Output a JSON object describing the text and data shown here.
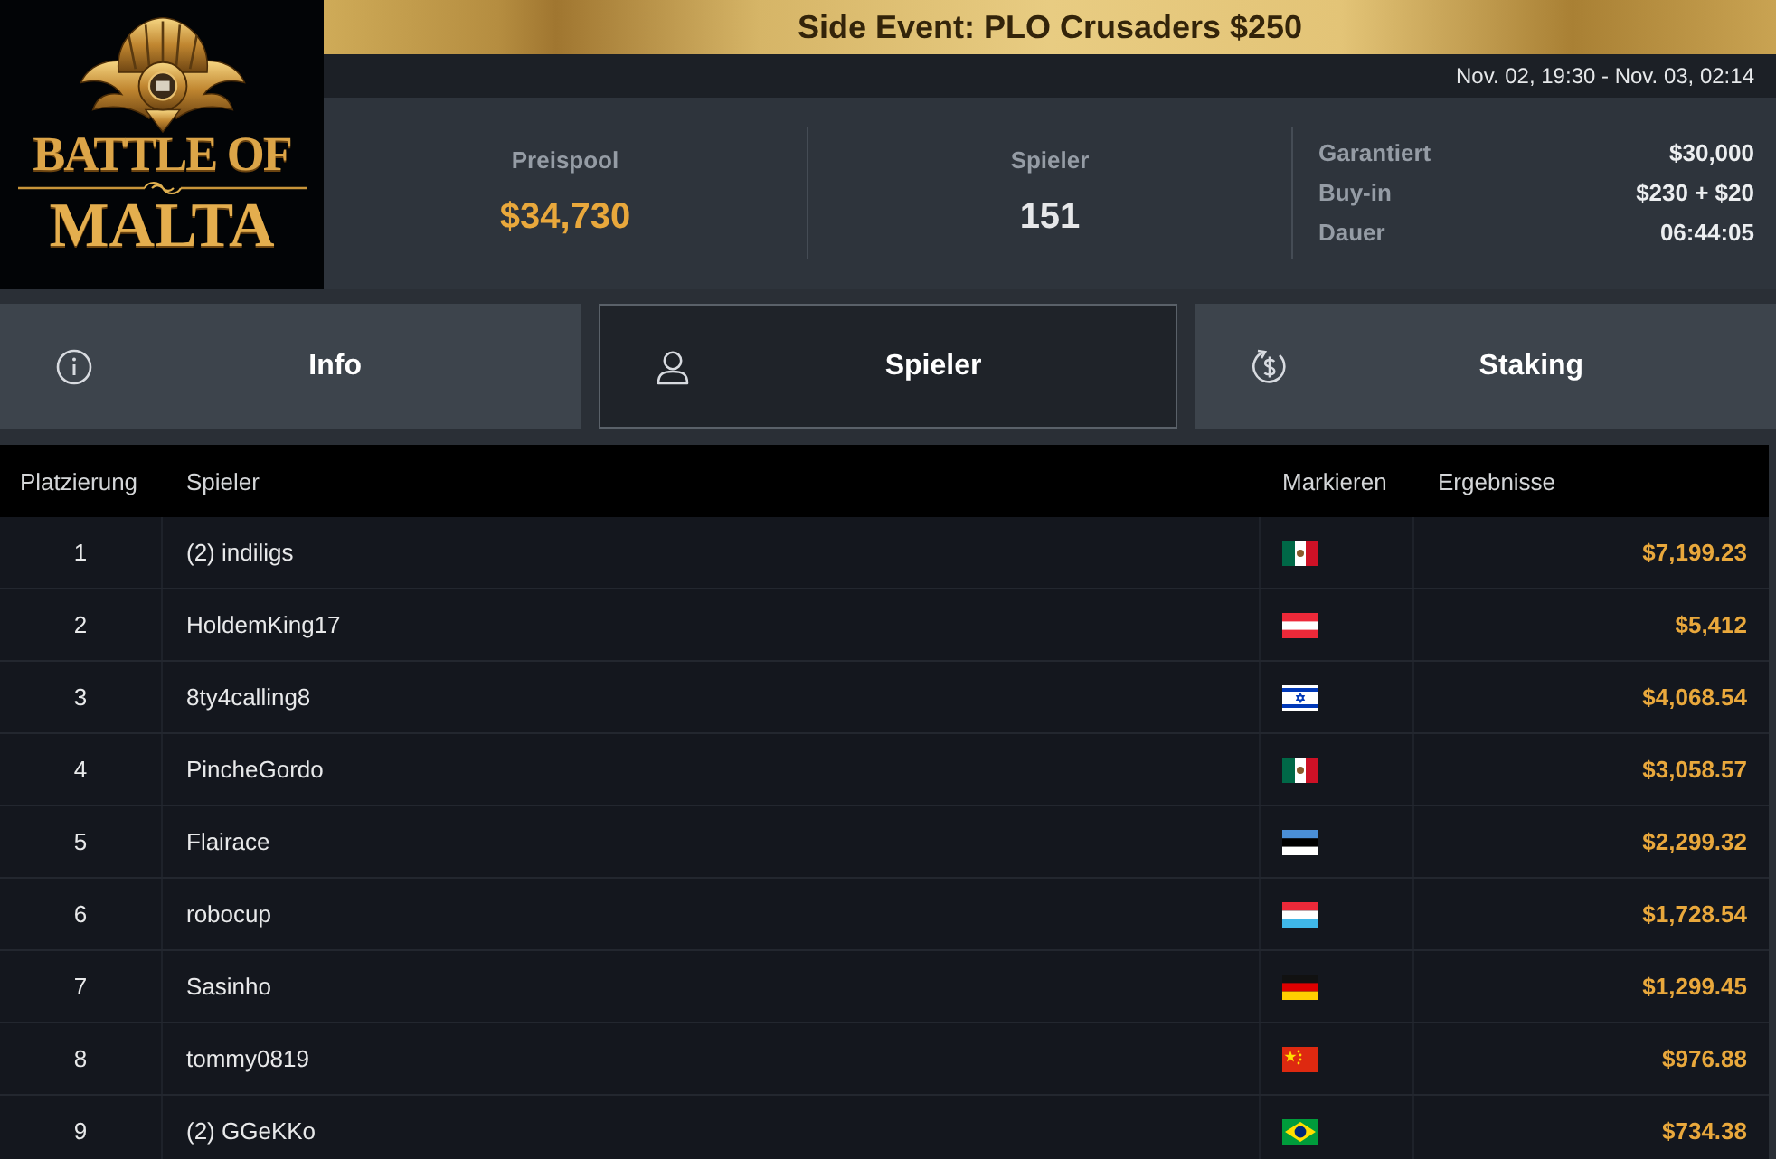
{
  "logo": {
    "line_1": "BATTLE OF",
    "line_2": "MALTA"
  },
  "title": "Side Event: PLO Crusaders $250",
  "date_range": "Nov. 02, 19:30 - Nov. 03, 02:14",
  "stats": {
    "prize_pool": {
      "label": "Preispool",
      "value": "$34,730"
    },
    "players": {
      "label": "Spieler",
      "value": "151"
    },
    "details": [
      {
        "label": "Garantiert",
        "value": "$30,000"
      },
      {
        "label": "Buy-in",
        "value": "$230 + $20"
      },
      {
        "label": "Dauer",
        "value": "06:44:05"
      }
    ]
  },
  "tabs": [
    {
      "label": "Info",
      "kind": "info",
      "selected": false
    },
    {
      "label": "Spieler",
      "kind": "players",
      "selected": true
    },
    {
      "label": "Staking",
      "kind": "staking",
      "selected": false
    }
  ],
  "table": {
    "columns": [
      "Platzierung",
      "Spieler",
      "Markieren",
      "Ergebnisse"
    ],
    "rows": [
      {
        "rank": "1",
        "player": "(2) indiligs",
        "kind": "mexico",
        "result": "$7,199.23"
      },
      {
        "rank": "2",
        "player": "HoldemKing17",
        "kind": "austria",
        "result": "$5,412"
      },
      {
        "rank": "3",
        "player": "8ty4calling8",
        "kind": "israel",
        "result": "$4,068.54"
      },
      {
        "rank": "4",
        "player": "PincheGordo",
        "kind": "mexico",
        "result": "$3,058.57"
      },
      {
        "rank": "5",
        "player": "Flairace",
        "kind": "estonia",
        "result": "$2,299.32"
      },
      {
        "rank": "6",
        "player": "robocup",
        "kind": "luxembourg",
        "result": "$1,728.54"
      },
      {
        "rank": "7",
        "player": "Sasinho",
        "kind": "germany",
        "result": "$1,299.45"
      },
      {
        "rank": "8",
        "player": "tommy0819",
        "kind": "china",
        "result": "$976.88"
      },
      {
        "rank": "9",
        "player": "(2) GGeKKo",
        "kind": "brazil",
        "result": "$734.38"
      }
    ]
  }
}
